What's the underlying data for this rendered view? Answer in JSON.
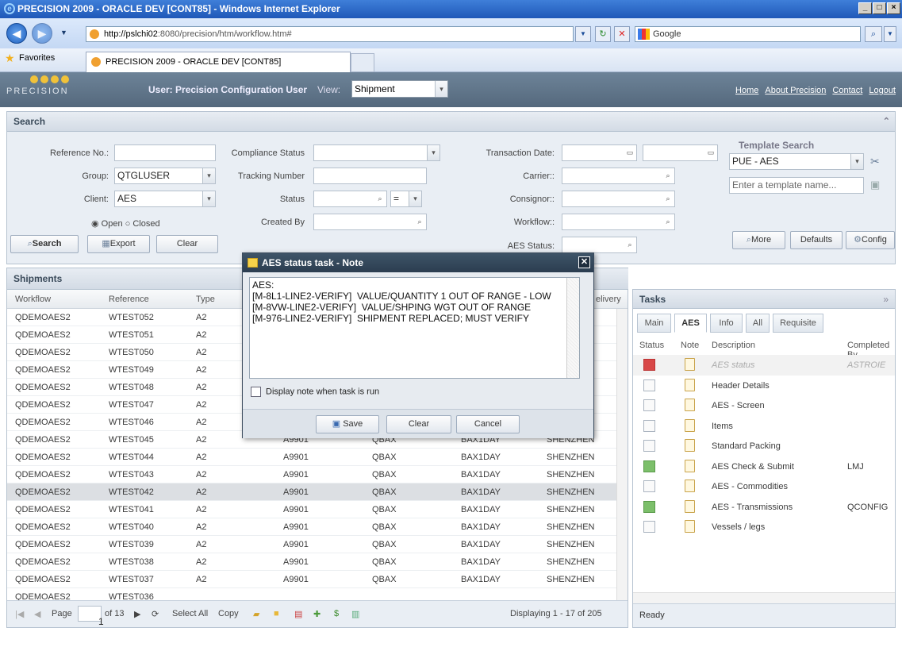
{
  "browser": {
    "title": "PRECISION 2009 - ORACLE DEV [CONT85] - Windows Internet Explorer",
    "url_host": "http://pslchi02",
    "url_rest": ":8080/precision/htm/workflow.htm#",
    "search_placeholder": "Google",
    "favorites_label": "Favorites",
    "tab_title": "PRECISION 2009 - ORACLE DEV [CONT85]"
  },
  "header": {
    "logo_text": "PRECISION",
    "user_label": "User: Precision Configuration User",
    "view_label": "View:",
    "view_value": "Shipment",
    "links": [
      "Home",
      "About Precision",
      "Contact",
      "Logout"
    ]
  },
  "search": {
    "title": "Search",
    "labels": {
      "reference": "Reference No.:",
      "group": "Group:",
      "client": "Client:",
      "compliance": "Compliance Status",
      "tracking": "Tracking Number",
      "status": "Status",
      "created_by": "Created By",
      "transaction_date": "Transaction Date:",
      "carrier": "Carrier::",
      "consignor": "Consignor::",
      "workflow": "Workflow::",
      "aes_status": "AES Status:"
    },
    "group_value": "QTGLUSER",
    "client_value": "AES",
    "status_op": "=",
    "open_label": "Open",
    "closed_label": "Closed",
    "buttons": {
      "search": "Search",
      "export": "Export",
      "clear": "Clear",
      "more": "More",
      "defaults": "Defaults",
      "config": "Config"
    },
    "template_title": "Template Search",
    "template_value": "PUE - AES",
    "template_placeholder": "Enter a template name..."
  },
  "shipments": {
    "title": "Shipments",
    "columns": [
      "Workflow",
      "Reference",
      "Type",
      "elivery"
    ],
    "rows": [
      [
        "QDEMOAES2",
        "WTEST052",
        "A2",
        "",
        "",
        "",
        ""
      ],
      [
        "QDEMOAES2",
        "WTEST051",
        "A2",
        "",
        "",
        "",
        ""
      ],
      [
        "QDEMOAES2",
        "WTEST050",
        "A2",
        "",
        "",
        "",
        ""
      ],
      [
        "QDEMOAES2",
        "WTEST049",
        "A2",
        "",
        "",
        "",
        ""
      ],
      [
        "QDEMOAES2",
        "WTEST048",
        "A2",
        "",
        "",
        "",
        ""
      ],
      [
        "QDEMOAES2",
        "WTEST047",
        "A2",
        "",
        "",
        "",
        ""
      ],
      [
        "QDEMOAES2",
        "WTEST046",
        "A2",
        "",
        "",
        "",
        ""
      ],
      [
        "QDEMOAES2",
        "WTEST045",
        "A2",
        "A9901",
        "QBAX",
        "BAX1DAY",
        "SHENZHEN"
      ],
      [
        "QDEMOAES2",
        "WTEST044",
        "A2",
        "A9901",
        "QBAX",
        "BAX1DAY",
        "SHENZHEN"
      ],
      [
        "QDEMOAES2",
        "WTEST043",
        "A2",
        "A9901",
        "QBAX",
        "BAX1DAY",
        "SHENZHEN"
      ],
      [
        "QDEMOAES2",
        "WTEST042",
        "A2",
        "A9901",
        "QBAX",
        "BAX1DAY",
        "SHENZHEN"
      ],
      [
        "QDEMOAES2",
        "WTEST041",
        "A2",
        "A9901",
        "QBAX",
        "BAX1DAY",
        "SHENZHEN"
      ],
      [
        "QDEMOAES2",
        "WTEST040",
        "A2",
        "A9901",
        "QBAX",
        "BAX1DAY",
        "SHENZHEN"
      ],
      [
        "QDEMOAES2",
        "WTEST039",
        "A2",
        "A9901",
        "QBAX",
        "BAX1DAY",
        "SHENZHEN"
      ],
      [
        "QDEMOAES2",
        "WTEST038",
        "A2",
        "A9901",
        "QBAX",
        "BAX1DAY",
        "SHENZHEN"
      ],
      [
        "QDEMOAES2",
        "WTEST037",
        "A2",
        "A9901",
        "QBAX",
        "BAX1DAY",
        "SHENZHEN"
      ],
      [
        "QDEMOAES2",
        "WTEST036",
        "",
        "",
        "",
        "",
        ""
      ]
    ],
    "selected_row": 10,
    "pager": {
      "page_label": "Page",
      "page_value": "1",
      "of_label": "of 13",
      "select_all": "Select All",
      "copy": "Copy",
      "displaying": "Displaying 1 - 17 of 205"
    }
  },
  "tasks": {
    "title": "Tasks",
    "tabs": [
      "Main",
      "AES",
      "Info",
      "All",
      "Requisite"
    ],
    "active_tab": "AES",
    "columns": [
      "Status",
      "Note",
      "Description",
      "Completed By"
    ],
    "rows": [
      {
        "desc": "AES status",
        "by": "ASTROIE",
        "state": "red"
      },
      {
        "desc": "Header Details",
        "by": "",
        "state": "empty"
      },
      {
        "desc": "AES - Screen",
        "by": "",
        "state": "empty"
      },
      {
        "desc": "Items",
        "by": "",
        "state": "empty"
      },
      {
        "desc": "Standard Packing",
        "by": "",
        "state": "empty"
      },
      {
        "desc": "AES Check & Submit",
        "by": "LMJ",
        "state": "green"
      },
      {
        "desc": "AES - Commodities",
        "by": "",
        "state": "empty"
      },
      {
        "desc": "AES - Transmissions",
        "by": "QCONFIG",
        "state": "green"
      },
      {
        "desc": "Vessels / legs",
        "by": "",
        "state": "empty"
      }
    ],
    "status_text": "Ready"
  },
  "dialog": {
    "title": "AES status task - Note",
    "note_text": "AES:\n[M-8L1-LINE2-VERIFY]  VALUE/QUANTITY 1 OUT OF RANGE - LOW\n[M-8VW-LINE2-VERIFY]  VALUE/SHPING WGT OUT OF RANGE\n[M-976-LINE2-VERIFY]  SHIPMENT REPLACED; MUST VERIFY",
    "checkbox_label": "Display note when task is run",
    "save": "Save",
    "clear": "Clear",
    "cancel": "Cancel"
  }
}
